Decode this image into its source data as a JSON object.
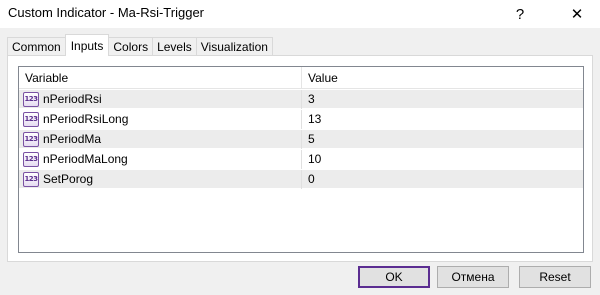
{
  "window": {
    "title": "Custom Indicator - Ma-Rsi-Trigger",
    "help_glyph": "?",
    "close_glyph": "✕"
  },
  "tabs": [
    {
      "label": "Common",
      "active": false
    },
    {
      "label": "Inputs",
      "active": true
    },
    {
      "label": "Colors",
      "active": false
    },
    {
      "label": "Levels",
      "active": false
    },
    {
      "label": "Visualization",
      "active": false
    }
  ],
  "grid": {
    "columns": {
      "variable": "Variable",
      "value": "Value"
    },
    "row_icon": "123",
    "rows": [
      {
        "variable": "nPeriodRsi",
        "value": "3"
      },
      {
        "variable": "nPeriodRsiLong",
        "value": "13"
      },
      {
        "variable": "nPeriodMa",
        "value": "5"
      },
      {
        "variable": "nPeriodMaLong",
        "value": "10"
      },
      {
        "variable": "SetPorog",
        "value": "0"
      }
    ]
  },
  "buttons": {
    "ok": "OK",
    "cancel": "Отмена",
    "reset": "Reset"
  },
  "colors": {
    "accent": "#5b2d91",
    "row_alt": "#ececec"
  }
}
